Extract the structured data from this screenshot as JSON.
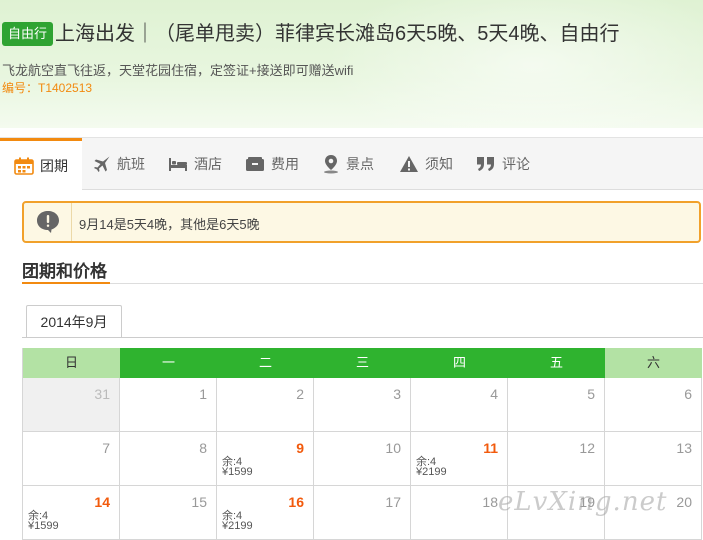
{
  "product": {
    "tag": "自由行",
    "title": "上海出发｜（尾单甩卖）菲律宾长滩岛6天5晚、5天4晚、自由行",
    "subtitle": "飞龙航空直飞往返，天堂花园住宿，定签证+接送即可赠送wifi",
    "code": "编号：T1402513"
  },
  "tabs": [
    {
      "label": "团期",
      "icon": "calendar-icon",
      "active": true
    },
    {
      "label": "航班",
      "icon": "airplane-icon"
    },
    {
      "label": "酒店",
      "icon": "bed-icon"
    },
    {
      "label": "费用",
      "icon": "wallet-icon"
    },
    {
      "label": "景点",
      "icon": "location-pin-icon"
    },
    {
      "label": "须知",
      "icon": "warning-icon"
    },
    {
      "label": "评论",
      "icon": "quote-icon"
    }
  ],
  "notice": {
    "text": "9月14是5天4晚，其他是6天5晚",
    "icon": "alert-bubble-icon"
  },
  "section": {
    "title": "团期和价格"
  },
  "month_tab": "2014年9月",
  "calendar": {
    "weekdays": [
      "日",
      "一",
      "二",
      "三",
      "四",
      "五",
      "六"
    ],
    "rows": [
      [
        {
          "day": "31",
          "prev": true
        },
        {
          "day": "1"
        },
        {
          "day": "2"
        },
        {
          "day": "3"
        },
        {
          "day": "4"
        },
        {
          "day": "5"
        },
        {
          "day": "6"
        }
      ],
      [
        {
          "day": "7"
        },
        {
          "day": "8"
        },
        {
          "day": "9",
          "left": "余:4",
          "price": "¥1599"
        },
        {
          "day": "10"
        },
        {
          "day": "11",
          "left": "余:4",
          "price": "¥2199"
        },
        {
          "day": "12"
        },
        {
          "day": "13"
        }
      ],
      [
        {
          "day": "14",
          "left": "余:4",
          "price": "¥1599"
        },
        {
          "day": "15"
        },
        {
          "day": "16",
          "left": "余:4",
          "price": "¥2199"
        },
        {
          "day": "17"
        },
        {
          "day": "18"
        },
        {
          "day": "19"
        },
        {
          "day": "20"
        }
      ]
    ]
  },
  "watermark": "eLvXing.net",
  "colors": {
    "brand_green": "#2fb32f",
    "accent_orange": "#f28a10",
    "date_highlight": "#f25a0c"
  }
}
